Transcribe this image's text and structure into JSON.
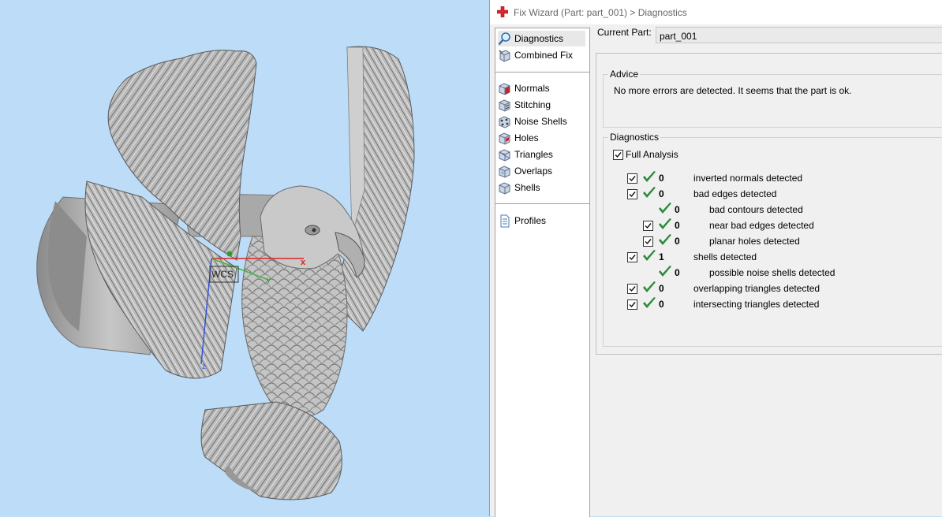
{
  "window": {
    "title": "Fix Wizard (Part: part_001) > Diagnostics"
  },
  "viewport": {
    "axis_x_label": "x",
    "axis_y_label": "y",
    "axis_z_label": "z",
    "wcs_label": "WCS"
  },
  "nav": {
    "items": [
      {
        "label": "Diagnostics",
        "icon": "magnifier-icon",
        "selected": true
      },
      {
        "label": "Combined Fix",
        "icon": "cube-wrench-icon"
      },
      {
        "label": "Normals",
        "icon": "cube-red-face-icon"
      },
      {
        "label": "Stitching",
        "icon": "cube-stitch-icon"
      },
      {
        "label": "Noise Shells",
        "icon": "noise-shells-icon"
      },
      {
        "label": "Holes",
        "icon": "cube-hole-icon"
      },
      {
        "label": "Triangles",
        "icon": "triangle-icon"
      },
      {
        "label": "Overlaps",
        "icon": "overlap-icon"
      },
      {
        "label": "Shells",
        "icon": "shell-icon"
      },
      {
        "label": "Profiles",
        "icon": "document-icon"
      }
    ]
  },
  "current_part": {
    "label": "Current Part:",
    "value": "part_001"
  },
  "advice": {
    "title": "Advice",
    "text": "No more errors are detected. It seems that the part is ok."
  },
  "diagnostics": {
    "title": "Diagnostics",
    "full_analysis_label": "Full Analysis",
    "full_analysis_checked": true,
    "rows": [
      {
        "count": "0",
        "label": "inverted normals detected",
        "checkbox": true,
        "checked": true
      },
      {
        "count": "0",
        "label": "bad edges detected",
        "checkbox": true,
        "checked": true
      },
      {
        "count": "0",
        "label": "bad contours detected",
        "checkbox": false
      },
      {
        "count": "0",
        "label": "near bad edges detected",
        "checkbox": true,
        "checked": true
      },
      {
        "count": "0",
        "label": "planar holes detected",
        "checkbox": true,
        "checked": true
      },
      {
        "count": "1",
        "label": "shells detected",
        "checkbox": true,
        "checked": true
      },
      {
        "count": "0",
        "label": "possible noise shells detected",
        "checkbox": false
      },
      {
        "count": "0",
        "label": "overlapping triangles detected",
        "checkbox": true,
        "checked": true
      },
      {
        "count": "0",
        "label": "intersecting triangles detected",
        "checkbox": true,
        "checked": true
      }
    ]
  },
  "colors": {
    "viewport_bg": "#bcdcf7",
    "check_green": "#2e8b3a",
    "title_icon_red": "#d9262b"
  }
}
